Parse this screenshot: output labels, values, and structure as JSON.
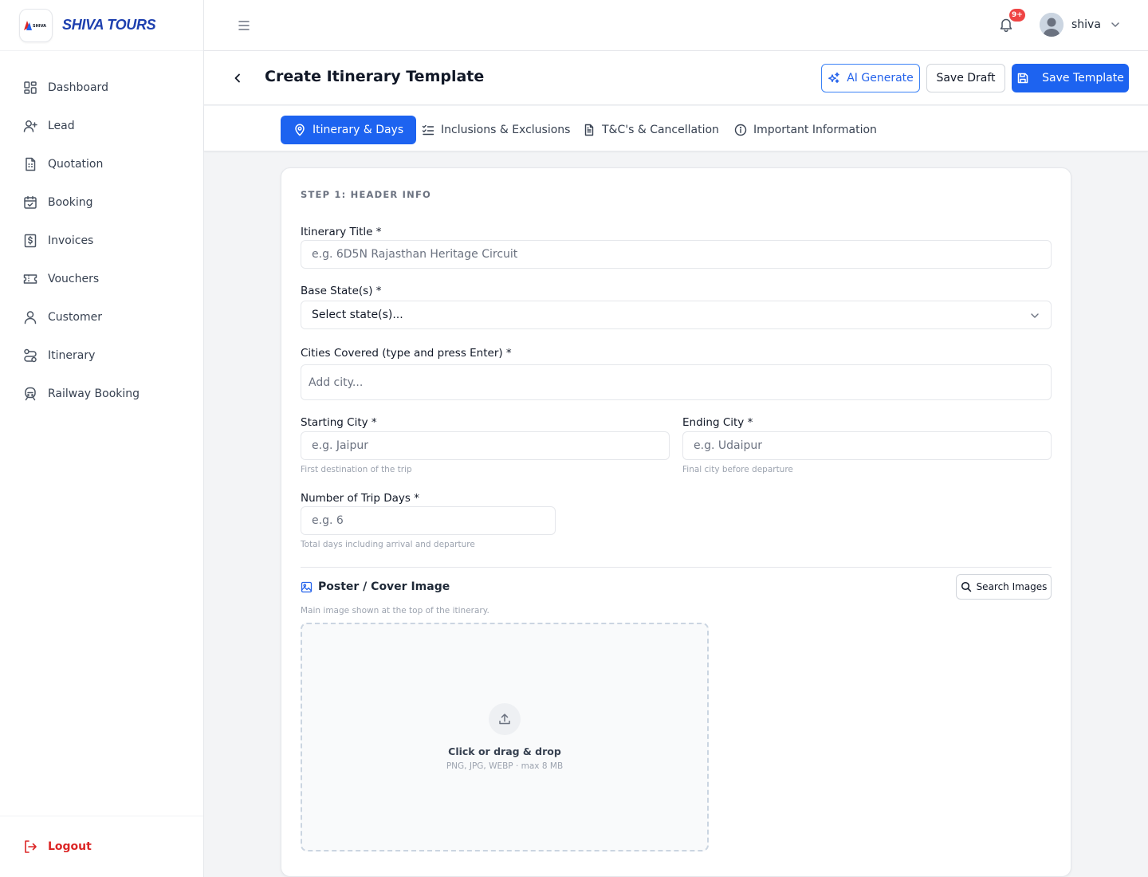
{
  "brand": {
    "name": "SHIVA TOURS",
    "logo_text": "SHIVA"
  },
  "sidebar": {
    "items": [
      {
        "label": "Dashboard",
        "icon": "dashboard-icon"
      },
      {
        "label": "Lead",
        "icon": "user-plus-icon"
      },
      {
        "label": "Quotation",
        "icon": "document-icon"
      },
      {
        "label": "Booking",
        "icon": "calendar-check-icon"
      },
      {
        "label": "Invoices",
        "icon": "dollar-receipt-icon"
      },
      {
        "label": "Vouchers",
        "icon": "ticket-icon"
      },
      {
        "label": "Customer",
        "icon": "user-icon"
      },
      {
        "label": "Itinerary",
        "icon": "route-icon"
      },
      {
        "label": "Railway Booking",
        "icon": "train-icon"
      }
    ],
    "logout_label": "Logout"
  },
  "topbar": {
    "notification_badge": "9+",
    "user_name": "shiva"
  },
  "header": {
    "title": "Create Itinerary Template",
    "ai_generate_label": "AI Generate",
    "save_draft_label": "Save Draft",
    "save_template_label": "Save Template"
  },
  "tabs": [
    {
      "label": "Itinerary & Days",
      "active": true
    },
    {
      "label": "Inclusions & Exclusions",
      "active": false
    },
    {
      "label": "T&C's & Cancellation",
      "active": false
    },
    {
      "label": "Important Information",
      "active": false
    }
  ],
  "form": {
    "step_title": "STEP 1: HEADER INFO",
    "itinerary_title": {
      "label": "Itinerary Title *",
      "placeholder": "e.g. 6D5N Rajasthan Heritage Circuit",
      "value": ""
    },
    "base_states": {
      "label": "Base State(s) *",
      "selected": "Select state(s)..."
    },
    "cities_covered": {
      "label": "Cities Covered (type and press Enter) *",
      "placeholder": "Add city...",
      "value": ""
    },
    "starting_city": {
      "label": "Starting City *",
      "placeholder": "e.g. Jaipur",
      "value": "",
      "hint": "First destination of the trip"
    },
    "ending_city": {
      "label": "Ending City *",
      "placeholder": "e.g. Udaipur",
      "value": "",
      "hint": "Final city before departure"
    },
    "trip_days": {
      "label": "Number of Trip Days *",
      "placeholder": "e.g. 6",
      "value": "",
      "hint": "Total days including arrival and departure"
    },
    "poster": {
      "title": "Poster / Cover Image",
      "description": "Main image shown at the top of the itinerary.",
      "search_label": "Search Images",
      "drop_title": "Click or drag & drop",
      "drop_subtitle": "PNG, JPG, WEBP · max 8 MB"
    }
  },
  "colors": {
    "primary": "#1d63f0",
    "brand": "#1e40af",
    "danger": "#dc2626",
    "badge": "#ef4444"
  }
}
